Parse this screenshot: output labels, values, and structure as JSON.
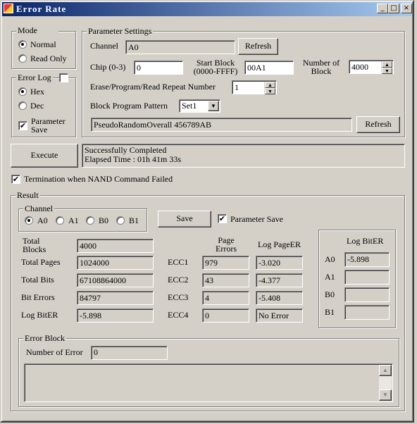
{
  "window": {
    "title": "Error Rate",
    "min": "_",
    "max": "□",
    "close": "×"
  },
  "mode": {
    "legend": "Mode Settings",
    "options": [
      "Normal",
      "Read Only"
    ],
    "selected": "Normal"
  },
  "error_log": {
    "legend": "Error Log",
    "enabled": false,
    "options": [
      "Hex",
      "Dec"
    ],
    "selected": "Hex",
    "param_save_label": "Parameter Save",
    "param_save": true
  },
  "params": {
    "legend": "Parameter Settings",
    "channel_label": "Channel",
    "channel_value": "A0",
    "refresh1": "Refresh",
    "chip_label": "Chip (0-3)",
    "chip_value": "0",
    "start_label": "Start Block (0000-FFFF)",
    "start_value": "00A1",
    "num_label": "Number of Block",
    "num_value": "4000",
    "repeat_label": "Erase/Program/Read Repeat Number",
    "repeat_value": "1",
    "pattern_label": "Block Program Pattern",
    "pattern_value": "Set1",
    "pattern_desc": "PseudoRandomOverall 456789AB",
    "refresh2": "Refresh"
  },
  "execute": "Execute",
  "status": [
    "Successfully Completed",
    "Elapsed Time : 01h 41m 33s"
  ],
  "termination": {
    "label": "Termination when NAND Command Failed",
    "checked": true
  },
  "result": {
    "legend": "Result",
    "channel_legend": "Channel",
    "channels": [
      "A0",
      "A1",
      "B0",
      "B1"
    ],
    "selected_channel": "A0",
    "save": "Save",
    "param_save_label": "Parameter Save",
    "param_save": true,
    "stats": [
      {
        "label": "Total Blocks",
        "value": "4000"
      },
      {
        "label": "Total Pages",
        "value": "1024000"
      },
      {
        "label": "Total Bits",
        "value": "67108864000"
      },
      {
        "label": "Bit Errors",
        "value": "84797"
      },
      {
        "label": "Log BitER",
        "value": "-5.898"
      }
    ],
    "page_errors_header": "Page Errors",
    "log_pageer_header": "Log PageER",
    "ecc": [
      {
        "label": "ECC1",
        "errors": "979",
        "log": "-3.020"
      },
      {
        "label": "ECC2",
        "errors": "43",
        "log": "-4.377"
      },
      {
        "label": "ECC3",
        "errors": "4",
        "log": "-5.408"
      },
      {
        "label": "ECC4",
        "errors": "0",
        "log": "No Error"
      }
    ],
    "log_biter": {
      "header": "Log BitER",
      "rows": [
        {
          "label": "A0",
          "value": "-5.898"
        },
        {
          "label": "A1",
          "value": ""
        },
        {
          "label": "B0",
          "value": ""
        },
        {
          "label": "B1",
          "value": ""
        }
      ]
    },
    "error_block": {
      "legend": "Error Block",
      "num_label": "Number of Error",
      "num_value": "0"
    }
  }
}
